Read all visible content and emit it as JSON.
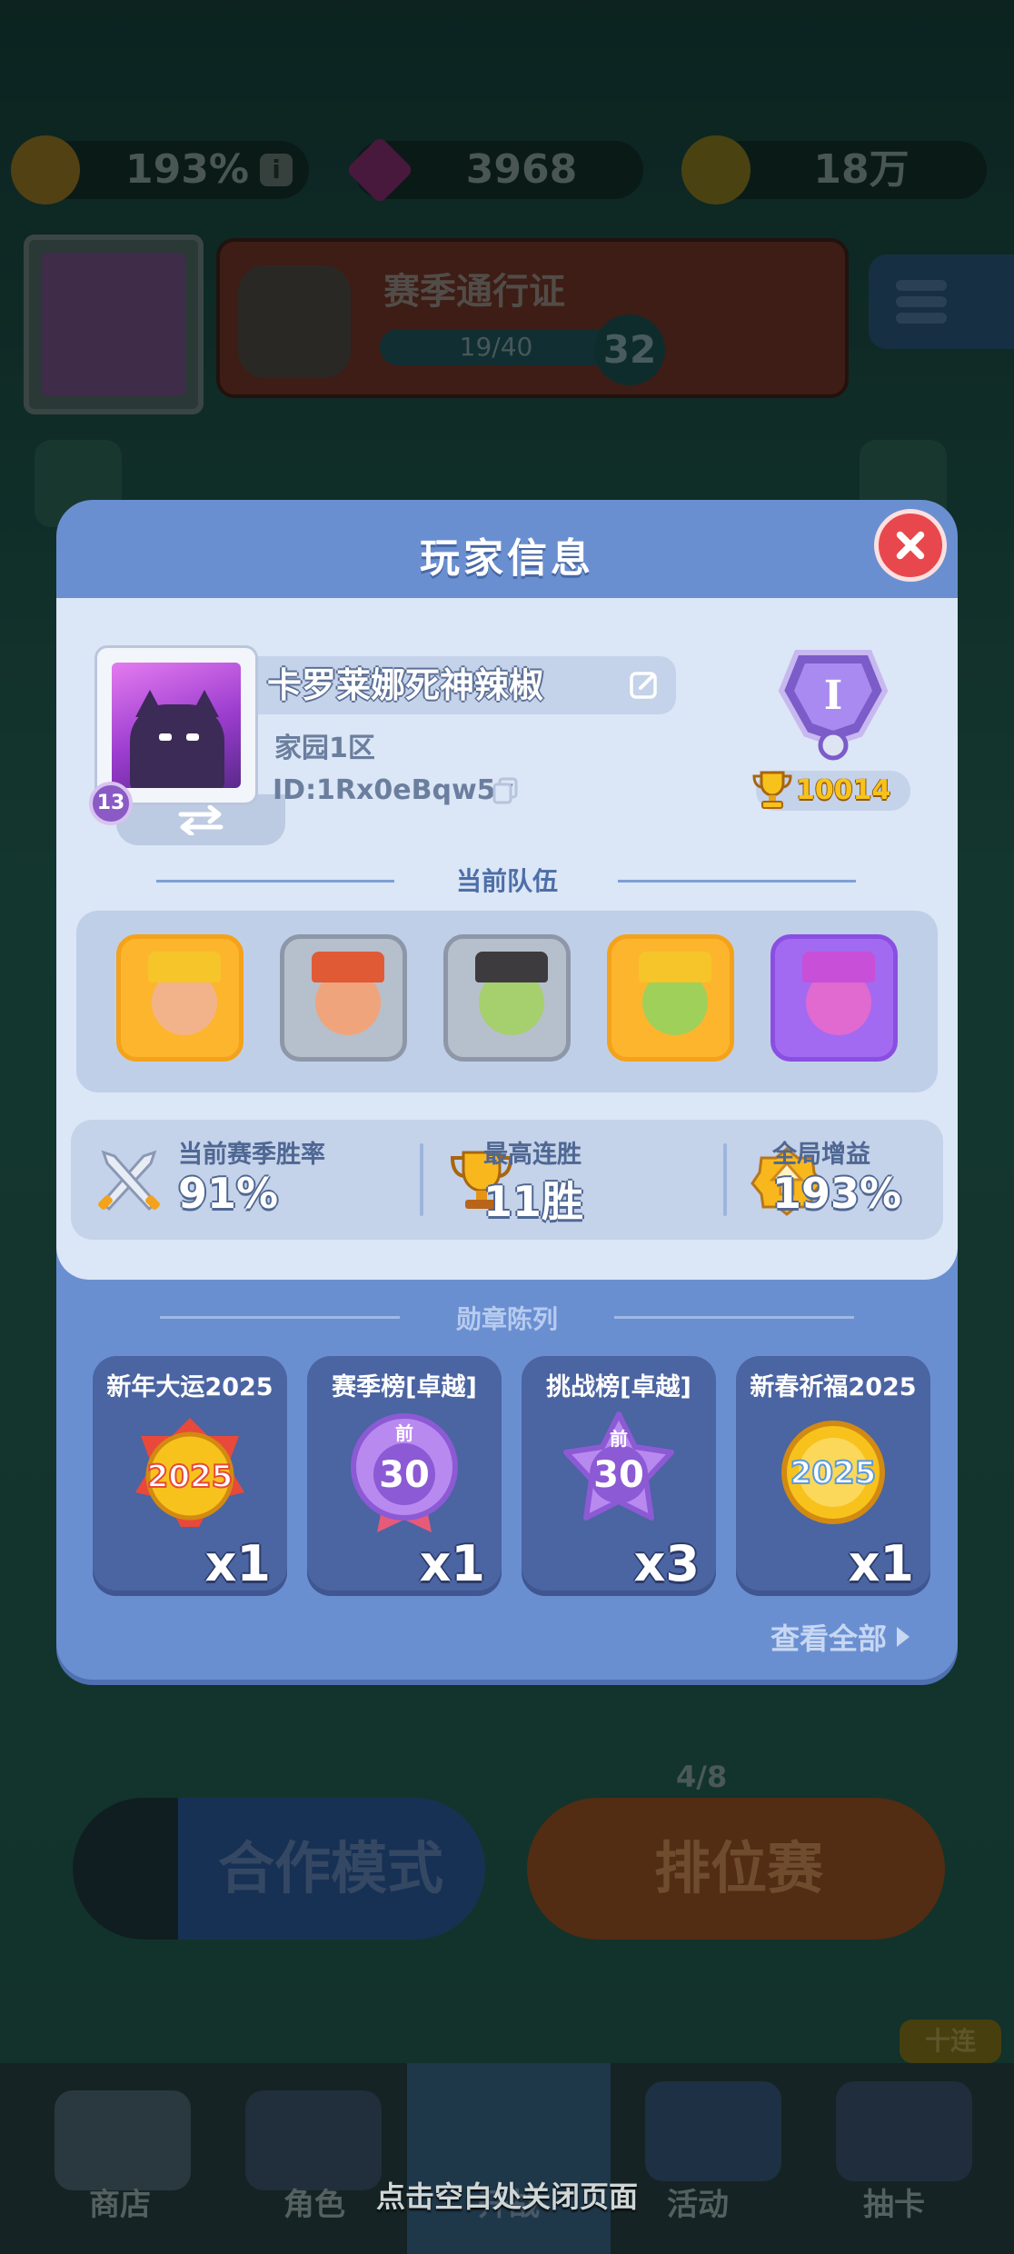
{
  "resources": {
    "boost_value": "193%",
    "gems_value": "3968",
    "coins_value": "18万"
  },
  "background": {
    "pass_title": "赛季通行证",
    "pass_progress": "19/40",
    "pass_level": "32",
    "player_level": "13",
    "coop_mode": "合作模式",
    "ranked_mode": "排位赛",
    "ranked_progress": "4/8",
    "draw_ten": "十连",
    "bg_count": "x3"
  },
  "nav": {
    "shop": "商店",
    "heroes": "角色",
    "battle": "开战",
    "events": "活动",
    "gacha": "抽卡"
  },
  "dialog": {
    "title": "玩家信息",
    "player": {
      "name": "卡罗莱娜死神辣椒",
      "server": "家园1区",
      "id": "ID:1Rx0eBqw5v",
      "level": "13",
      "rank_numeral": "I",
      "trophies": "10014"
    },
    "team_header": "当前队伍",
    "team": [
      {
        "name": "king-hero",
        "frame": "#f4a21a"
      },
      {
        "name": "warrior-hero",
        "frame": "#8d97a8"
      },
      {
        "name": "goblin-hero",
        "frame": "#8d97a8"
      },
      {
        "name": "goblin-king-hero",
        "frame": "#f4a21a"
      },
      {
        "name": "wrestler-hero",
        "frame": "#8a4fe0"
      }
    ],
    "stats": {
      "winrate_label": "当前赛季胜率",
      "winrate_value": "91%",
      "streak_label": "最高连胜",
      "streak_value": "11胜",
      "boost_label": "全局增益",
      "boost_value": "193%"
    },
    "medals_header": "勋章陈列",
    "medals": [
      {
        "name": "新年大运2025",
        "count": "x1",
        "art": "2025"
      },
      {
        "name": "赛季榜[卓越]",
        "count": "x1",
        "art": "30",
        "top": "前"
      },
      {
        "name": "挑战榜[卓越]",
        "count": "x3",
        "art": "30",
        "top": "前"
      },
      {
        "name": "新春祈福2025",
        "count": "x1",
        "art": "2025"
      }
    ],
    "view_all": "查看全部"
  },
  "close_hint": "点击空白处关闭页面",
  "colors": {
    "dialog_bg": "#6a8fd1",
    "panel_bg": "#dbe6f6",
    "close_red": "#e8484d",
    "gold": "#f8c21d",
    "medal_card": "#4b64a2"
  }
}
